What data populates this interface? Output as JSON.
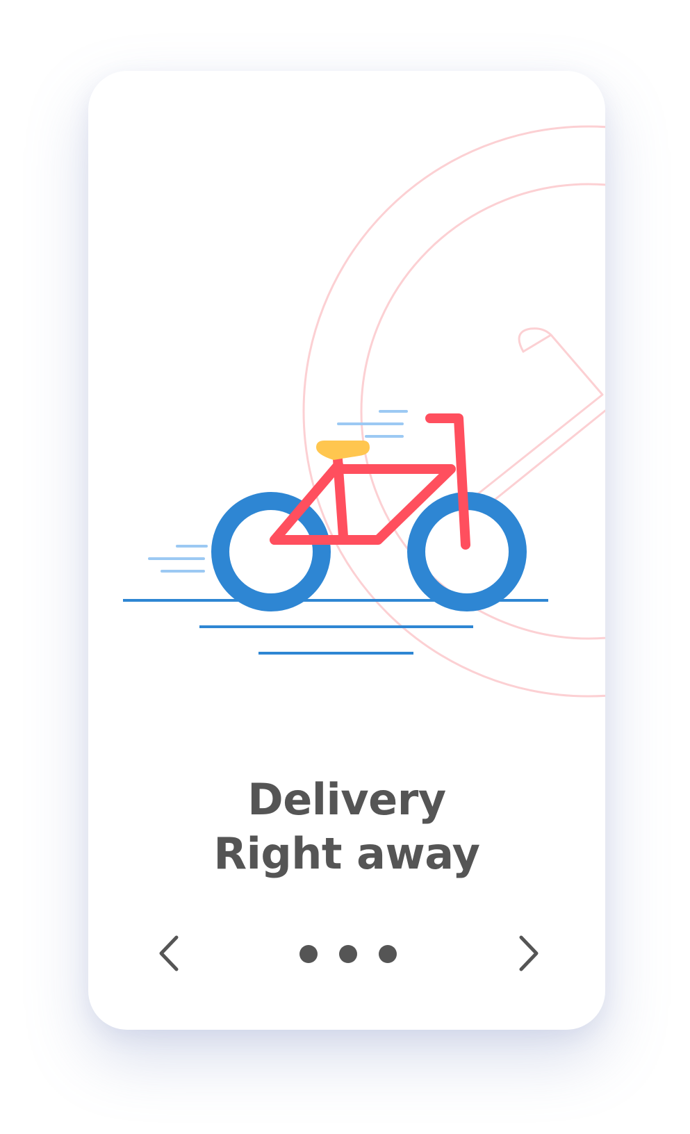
{
  "onboarding": {
    "headline_line1": "Delivery",
    "headline_line2": "Right away",
    "page_count": 3,
    "icons": {
      "illustration": "bicycle-icon",
      "background": "location-pin-icon",
      "prev": "chevron-left-icon",
      "next": "chevron-right-icon"
    }
  },
  "colors": {
    "wheels": "#2e86d3",
    "frame": "#ff4f5e",
    "seat": "#ffc64f",
    "speed_lines": "#9cc9f3",
    "ground": "#2e86d3",
    "background_outline": "#fcd0d3",
    "text": "#555555"
  }
}
